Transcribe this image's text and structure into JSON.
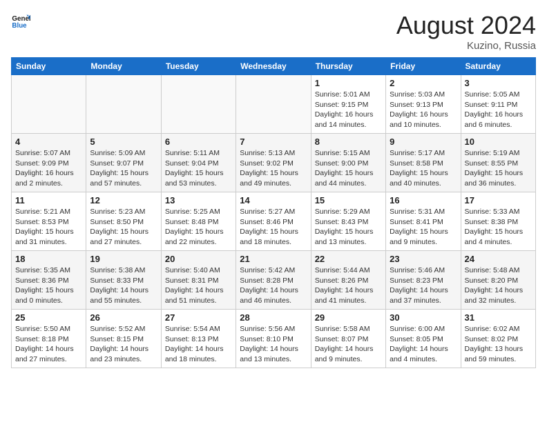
{
  "logo": {
    "line1": "General",
    "line2": "Blue"
  },
  "title": "August 2024",
  "location": "Kuzino, Russia",
  "days_of_week": [
    "Sunday",
    "Monday",
    "Tuesday",
    "Wednesday",
    "Thursday",
    "Friday",
    "Saturday"
  ],
  "weeks": [
    [
      {
        "day": "",
        "info": ""
      },
      {
        "day": "",
        "info": ""
      },
      {
        "day": "",
        "info": ""
      },
      {
        "day": "",
        "info": ""
      },
      {
        "day": "1",
        "info": "Sunrise: 5:01 AM\nSunset: 9:15 PM\nDaylight: 16 hours\nand 14 minutes."
      },
      {
        "day": "2",
        "info": "Sunrise: 5:03 AM\nSunset: 9:13 PM\nDaylight: 16 hours\nand 10 minutes."
      },
      {
        "day": "3",
        "info": "Sunrise: 5:05 AM\nSunset: 9:11 PM\nDaylight: 16 hours\nand 6 minutes."
      }
    ],
    [
      {
        "day": "4",
        "info": "Sunrise: 5:07 AM\nSunset: 9:09 PM\nDaylight: 16 hours\nand 2 minutes."
      },
      {
        "day": "5",
        "info": "Sunrise: 5:09 AM\nSunset: 9:07 PM\nDaylight: 15 hours\nand 57 minutes."
      },
      {
        "day": "6",
        "info": "Sunrise: 5:11 AM\nSunset: 9:04 PM\nDaylight: 15 hours\nand 53 minutes."
      },
      {
        "day": "7",
        "info": "Sunrise: 5:13 AM\nSunset: 9:02 PM\nDaylight: 15 hours\nand 49 minutes."
      },
      {
        "day": "8",
        "info": "Sunrise: 5:15 AM\nSunset: 9:00 PM\nDaylight: 15 hours\nand 44 minutes."
      },
      {
        "day": "9",
        "info": "Sunrise: 5:17 AM\nSunset: 8:58 PM\nDaylight: 15 hours\nand 40 minutes."
      },
      {
        "day": "10",
        "info": "Sunrise: 5:19 AM\nSunset: 8:55 PM\nDaylight: 15 hours\nand 36 minutes."
      }
    ],
    [
      {
        "day": "11",
        "info": "Sunrise: 5:21 AM\nSunset: 8:53 PM\nDaylight: 15 hours\nand 31 minutes."
      },
      {
        "day": "12",
        "info": "Sunrise: 5:23 AM\nSunset: 8:50 PM\nDaylight: 15 hours\nand 27 minutes."
      },
      {
        "day": "13",
        "info": "Sunrise: 5:25 AM\nSunset: 8:48 PM\nDaylight: 15 hours\nand 22 minutes."
      },
      {
        "day": "14",
        "info": "Sunrise: 5:27 AM\nSunset: 8:46 PM\nDaylight: 15 hours\nand 18 minutes."
      },
      {
        "day": "15",
        "info": "Sunrise: 5:29 AM\nSunset: 8:43 PM\nDaylight: 15 hours\nand 13 minutes."
      },
      {
        "day": "16",
        "info": "Sunrise: 5:31 AM\nSunset: 8:41 PM\nDaylight: 15 hours\nand 9 minutes."
      },
      {
        "day": "17",
        "info": "Sunrise: 5:33 AM\nSunset: 8:38 PM\nDaylight: 15 hours\nand 4 minutes."
      }
    ],
    [
      {
        "day": "18",
        "info": "Sunrise: 5:35 AM\nSunset: 8:36 PM\nDaylight: 15 hours\nand 0 minutes."
      },
      {
        "day": "19",
        "info": "Sunrise: 5:38 AM\nSunset: 8:33 PM\nDaylight: 14 hours\nand 55 minutes."
      },
      {
        "day": "20",
        "info": "Sunrise: 5:40 AM\nSunset: 8:31 PM\nDaylight: 14 hours\nand 51 minutes."
      },
      {
        "day": "21",
        "info": "Sunrise: 5:42 AM\nSunset: 8:28 PM\nDaylight: 14 hours\nand 46 minutes."
      },
      {
        "day": "22",
        "info": "Sunrise: 5:44 AM\nSunset: 8:26 PM\nDaylight: 14 hours\nand 41 minutes."
      },
      {
        "day": "23",
        "info": "Sunrise: 5:46 AM\nSunset: 8:23 PM\nDaylight: 14 hours\nand 37 minutes."
      },
      {
        "day": "24",
        "info": "Sunrise: 5:48 AM\nSunset: 8:20 PM\nDaylight: 14 hours\nand 32 minutes."
      }
    ],
    [
      {
        "day": "25",
        "info": "Sunrise: 5:50 AM\nSunset: 8:18 PM\nDaylight: 14 hours\nand 27 minutes."
      },
      {
        "day": "26",
        "info": "Sunrise: 5:52 AM\nSunset: 8:15 PM\nDaylight: 14 hours\nand 23 minutes."
      },
      {
        "day": "27",
        "info": "Sunrise: 5:54 AM\nSunset: 8:13 PM\nDaylight: 14 hours\nand 18 minutes."
      },
      {
        "day": "28",
        "info": "Sunrise: 5:56 AM\nSunset: 8:10 PM\nDaylight: 14 hours\nand 13 minutes."
      },
      {
        "day": "29",
        "info": "Sunrise: 5:58 AM\nSunset: 8:07 PM\nDaylight: 14 hours\nand 9 minutes."
      },
      {
        "day": "30",
        "info": "Sunrise: 6:00 AM\nSunset: 8:05 PM\nDaylight: 14 hours\nand 4 minutes."
      },
      {
        "day": "31",
        "info": "Sunrise: 6:02 AM\nSunset: 8:02 PM\nDaylight: 13 hours\nand 59 minutes."
      }
    ]
  ]
}
